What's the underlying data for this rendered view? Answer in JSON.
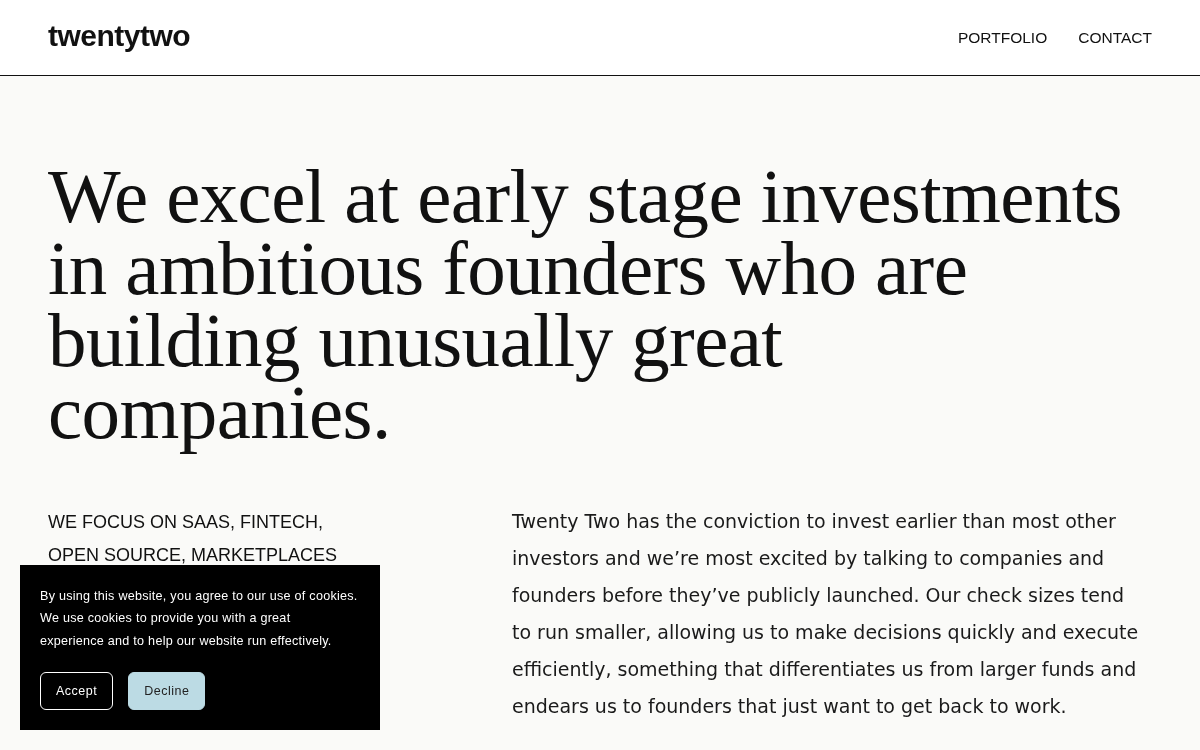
{
  "header": {
    "logo": "twentytwo",
    "nav": [
      "PORTFOLIO",
      "CONTACT"
    ]
  },
  "hero": {
    "headline_lines": [
      "We excel at early stage investments",
      "in ambitious founders who are",
      "building unusually great",
      "companies."
    ]
  },
  "focus": "WE FOCUS ON SAAS, FINTECH, OPEN SOURCE, MARKETPLACES",
  "about_lines": [
    "Twenty Two has the conviction to invest earlier than most other",
    "investors and we’re most excited by talking to companies and",
    "founders before they’ve publicly launched. Our check sizes tend",
    "to run smaller, allowing us to make decisions quickly and execute",
    "efficiently, something that differentiates us from larger funds and",
    "endears us to founders that just want to get back to work."
  ],
  "cookie_banner": {
    "message_lines": [
      "By using this website, you agree to our use of cookies.",
      "We use cookies to provide you with a great",
      "experience and to help our website run effectively."
    ],
    "buttons": [
      {
        "label": "Accept",
        "kind": "outline"
      },
      {
        "label": "Decline",
        "kind": "filled"
      }
    ]
  }
}
